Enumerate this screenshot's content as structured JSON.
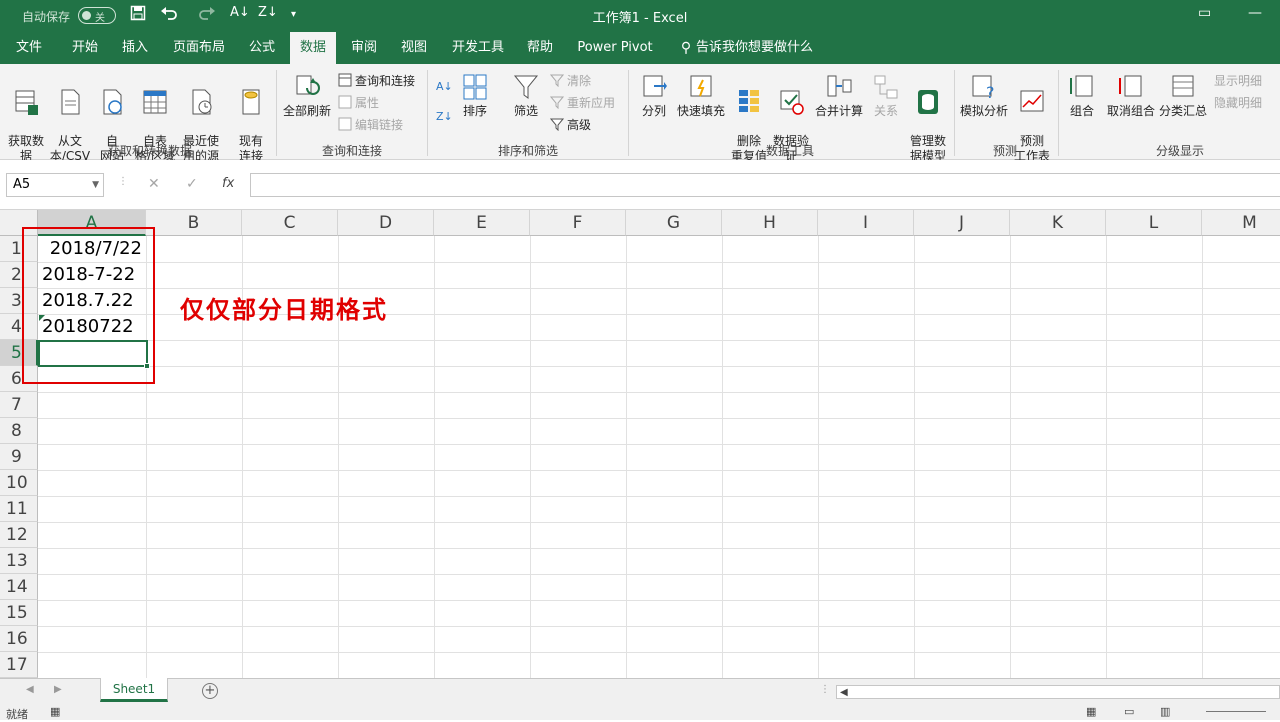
{
  "titlebar": {
    "autosave_label": "自动保存",
    "autosave_state": "关",
    "window_title": "工作簿1 - Excel"
  },
  "tabs": [
    {
      "label": "文件"
    },
    {
      "label": "开始"
    },
    {
      "label": "插入"
    },
    {
      "label": "页面布局"
    },
    {
      "label": "公式"
    },
    {
      "label": "数据"
    },
    {
      "label": "审阅"
    },
    {
      "label": "视图"
    },
    {
      "label": "开发工具"
    },
    {
      "label": "帮助"
    },
    {
      "label": "Power Pivot"
    }
  ],
  "tell_me": "告诉我你想要做什么",
  "ribbon": {
    "get_data": "获取数\n据",
    "from_text": "从文\n本/CSV",
    "from_web": "自\n网站",
    "from_table": "自表\n格/区域",
    "recent_sources": "最近使\n用的源",
    "existing_conn": "现有\n连接",
    "group_get": "获取和转换数据",
    "refresh_all": "全部刷新",
    "queries_conn": "查询和连接",
    "properties": "属性",
    "edit_links": "编辑链接",
    "group_queries": "查询和连接",
    "sort": "排序",
    "filter": "筛选",
    "clear": "清除",
    "reapply": "重新应用",
    "advanced": "高级",
    "group_sort": "排序和筛选",
    "text_to_cols": "分列",
    "flash_fill": "快速填充",
    "remove_dup": "删除\n重复值",
    "validation": "数据验\n证",
    "consolidate": "合并计算",
    "relationships": "关系",
    "manage_model": "管理数\n据模型",
    "group_tools": "数据工具",
    "whatif": "模拟分析",
    "forecast": "预测\n工作表",
    "group_forecast": "预测",
    "group_btn": "组合",
    "ungroup": "取消组合",
    "subtotal": "分类汇总",
    "show_detail": "显示明细",
    "hide_detail": "隐藏明细",
    "group_outline": "分级显示"
  },
  "formula_bar": {
    "name_box": "A5",
    "cancel": "✕",
    "enter": "✓",
    "fx": "fx",
    "formula": ""
  },
  "columns": [
    "A",
    "B",
    "C",
    "D",
    "E",
    "F",
    "G",
    "H",
    "I",
    "J",
    "K",
    "L",
    "M"
  ],
  "rows": [
    "1",
    "2",
    "3",
    "4",
    "5",
    "6",
    "7",
    "8",
    "9",
    "10",
    "11",
    "12",
    "13",
    "14",
    "15",
    "16",
    "17"
  ],
  "cells": {
    "A1": "2018/7/22",
    "A2": "2018-7-22",
    "A3": "2018.7.22",
    "A4": "20180722"
  },
  "annotation": "仅仅部分日期格式",
  "sheet_tab": "Sheet1",
  "add_sheet": "+",
  "status": "就绪"
}
